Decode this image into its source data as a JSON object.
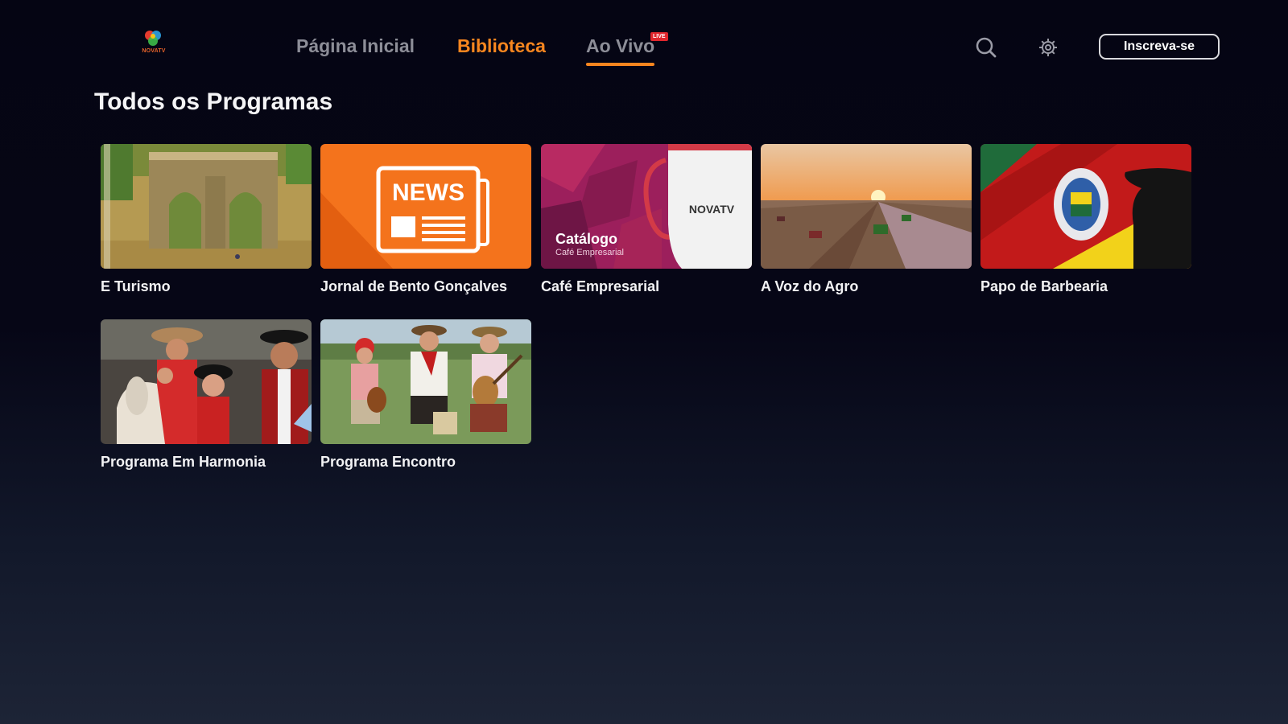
{
  "app": {
    "logo_text": "NOVATV"
  },
  "nav": {
    "items": [
      {
        "label": "Página Inicial"
      },
      {
        "label": "Biblioteca"
      },
      {
        "label": "Ao Vivo"
      }
    ],
    "live_badge": "LIVE",
    "active_color": "#f7861f",
    "inactive_color": "#8d8e98"
  },
  "header": {
    "subscribe_label": "Inscreva-se"
  },
  "main": {
    "section_title": "Todos os Programas",
    "programs": [
      {
        "title": "E Turismo",
        "thumb_icon": "stone-ruins-image"
      },
      {
        "title": "Jornal de Bento Gonçalves",
        "thumb_icon": "news-newspaper-image",
        "thumb_text": "NEWS"
      },
      {
        "title": "Café Empresarial",
        "thumb_icon": "coffee-mug-image",
        "thumb_text": "Catálogo",
        "thumb_subtext": "Café Empresarial",
        "mug_text": "NOVATV"
      },
      {
        "title": "A Voz do Agro",
        "thumb_icon": "harvest-field-sunset-image"
      },
      {
        "title": "Papo de Barbearia",
        "thumb_icon": "rs-flag-gaucho-image"
      },
      {
        "title": "Programa Em Harmonia",
        "thumb_icon": "family-gaucho-horse-image"
      },
      {
        "title": "Programa Encontro",
        "thumb_icon": "gaucho-musicians-image"
      }
    ]
  },
  "colors": {
    "accent": "#f7861f",
    "background": "#050513",
    "live_red": "#e0262d"
  }
}
